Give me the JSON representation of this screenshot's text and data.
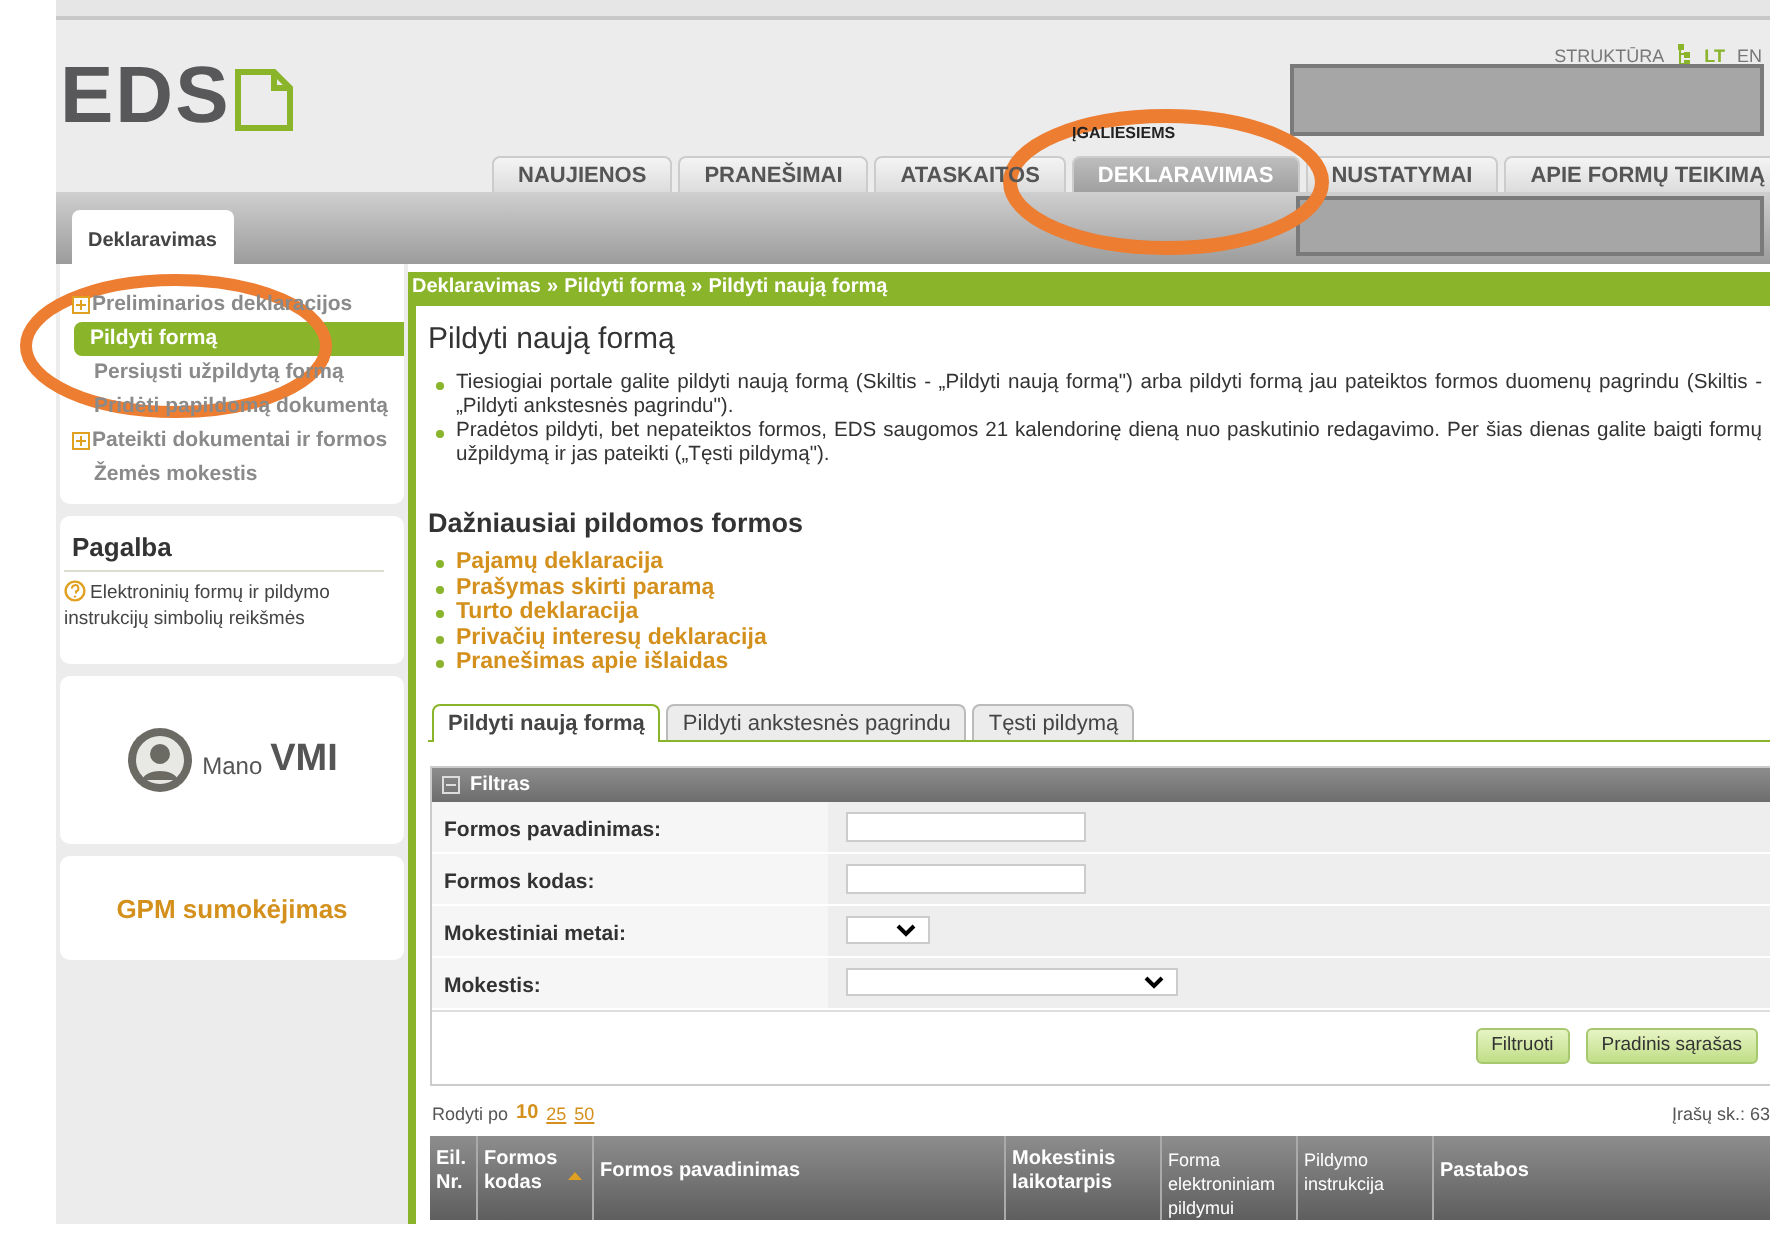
{
  "header": {
    "logo": "EDS",
    "links": [
      "STRUKTŪRA"
    ],
    "languages": [
      {
        "label": "LT",
        "selected": true
      },
      {
        "label": "EN",
        "selected": false
      }
    ],
    "authorized_link": "ĮGALIESIEMS"
  },
  "main_tabs": [
    {
      "label": "NAUJIENOS",
      "selected": false
    },
    {
      "label": "PRANEŠIMAI",
      "selected": false
    },
    {
      "label": "ATASKAITOS",
      "selected": false
    },
    {
      "label": "DEKLARAVIMAS",
      "selected": true
    },
    {
      "label": "NUSTATYMAI",
      "selected": false
    },
    {
      "label": "APIE FORMŲ TEIKIMĄ",
      "selected": false
    }
  ],
  "sub_tab": "Deklaravimas",
  "sidebar": {
    "items": [
      {
        "label": "Preliminarios deklaracijos",
        "expandable": true,
        "selected": false
      },
      {
        "label": "Pildyti formą",
        "expandable": false,
        "selected": true
      },
      {
        "label": "Persiųsti užpildytą formą",
        "expandable": false,
        "selected": false
      },
      {
        "label": "Pridėti papildomą dokumentą",
        "expandable": false,
        "selected": false
      },
      {
        "label": "Pateikti dokumentai ir formos",
        "expandable": true,
        "selected": false
      },
      {
        "label": "Žemės mokestis",
        "expandable": false,
        "selected": false
      }
    ],
    "help_title": "Pagalba",
    "help_link": "Elektroninių formų ir pildymo instrukcijų simbolių reikšmės",
    "mano_vmi": {
      "prefix": "Mano",
      "name": "VMI"
    },
    "gpm": "GPM sumokėjimas"
  },
  "breadcrumb": [
    "Deklaravimas",
    "Pildyti formą",
    "Pildyti naują formą"
  ],
  "breadcrumb_separator": "»",
  "page_title": "Pildyti naują formą",
  "info": [
    "Tiesiogiai portale galite pildyti naują formą (Skiltis - „Pildyti naują formą\") arba pildyti formą jau pateiktos formos duomenų pagrindu (Skiltis - „Pildyti ankstesnės pagrindu\").",
    "Pradėtos pildyti, bet nepateiktos formos, EDS saugomos 21 kalendorinę dieną nuo paskutinio redagavimo. Per šias dienas galite baigti formų užpildymą ir jas pateikti („Tęsti pildymą\")."
  ],
  "frequent_title": "Dažniausiai pildomos formos",
  "frequent_forms": [
    "Pajamų deklaracija",
    "Prašymas skirti paramą",
    "Turto deklaracija",
    "Privačių interesų deklaracija",
    "Pranešimas apie išlaidas"
  ],
  "form_tabs": [
    {
      "label": "Pildyti naują formą",
      "selected": true
    },
    {
      "label": "Pildyti ankstesnės pagrindu",
      "selected": false
    },
    {
      "label": "Tęsti pildymą",
      "selected": false
    }
  ],
  "filter": {
    "title": "Filtras",
    "fields": [
      {
        "label": "Formos pavadinimas:",
        "kind": "text"
      },
      {
        "label": "Formos kodas:",
        "kind": "text"
      },
      {
        "label": "Mokestiniai metai:",
        "kind": "select-small"
      },
      {
        "label": "Mokestis:",
        "kind": "select-wide"
      }
    ],
    "buttons": [
      "Filtruoti",
      "Pradinis sąrašas"
    ]
  },
  "paging": {
    "label": "Rodyti po",
    "options": [
      {
        "label": "10",
        "selected": true
      },
      {
        "label": "25",
        "selected": false
      },
      {
        "label": "50",
        "selected": false
      }
    ],
    "count": "Įrašų sk.: 63"
  },
  "table": {
    "columns": [
      {
        "label": "Eil. Nr.",
        "sorted": false
      },
      {
        "label": "Formos kodas",
        "sorted": true
      },
      {
        "label": "Formos pavadinimas",
        "sorted": false
      },
      {
        "label": "Mokestinis laikotarpis",
        "sorted": false
      },
      {
        "label": "Forma elektroniniam pildymui",
        "sorted": false
      },
      {
        "label": "Pildymo instrukcija",
        "sorted": false
      },
      {
        "label": "Pastabos",
        "sorted": false
      }
    ]
  }
}
